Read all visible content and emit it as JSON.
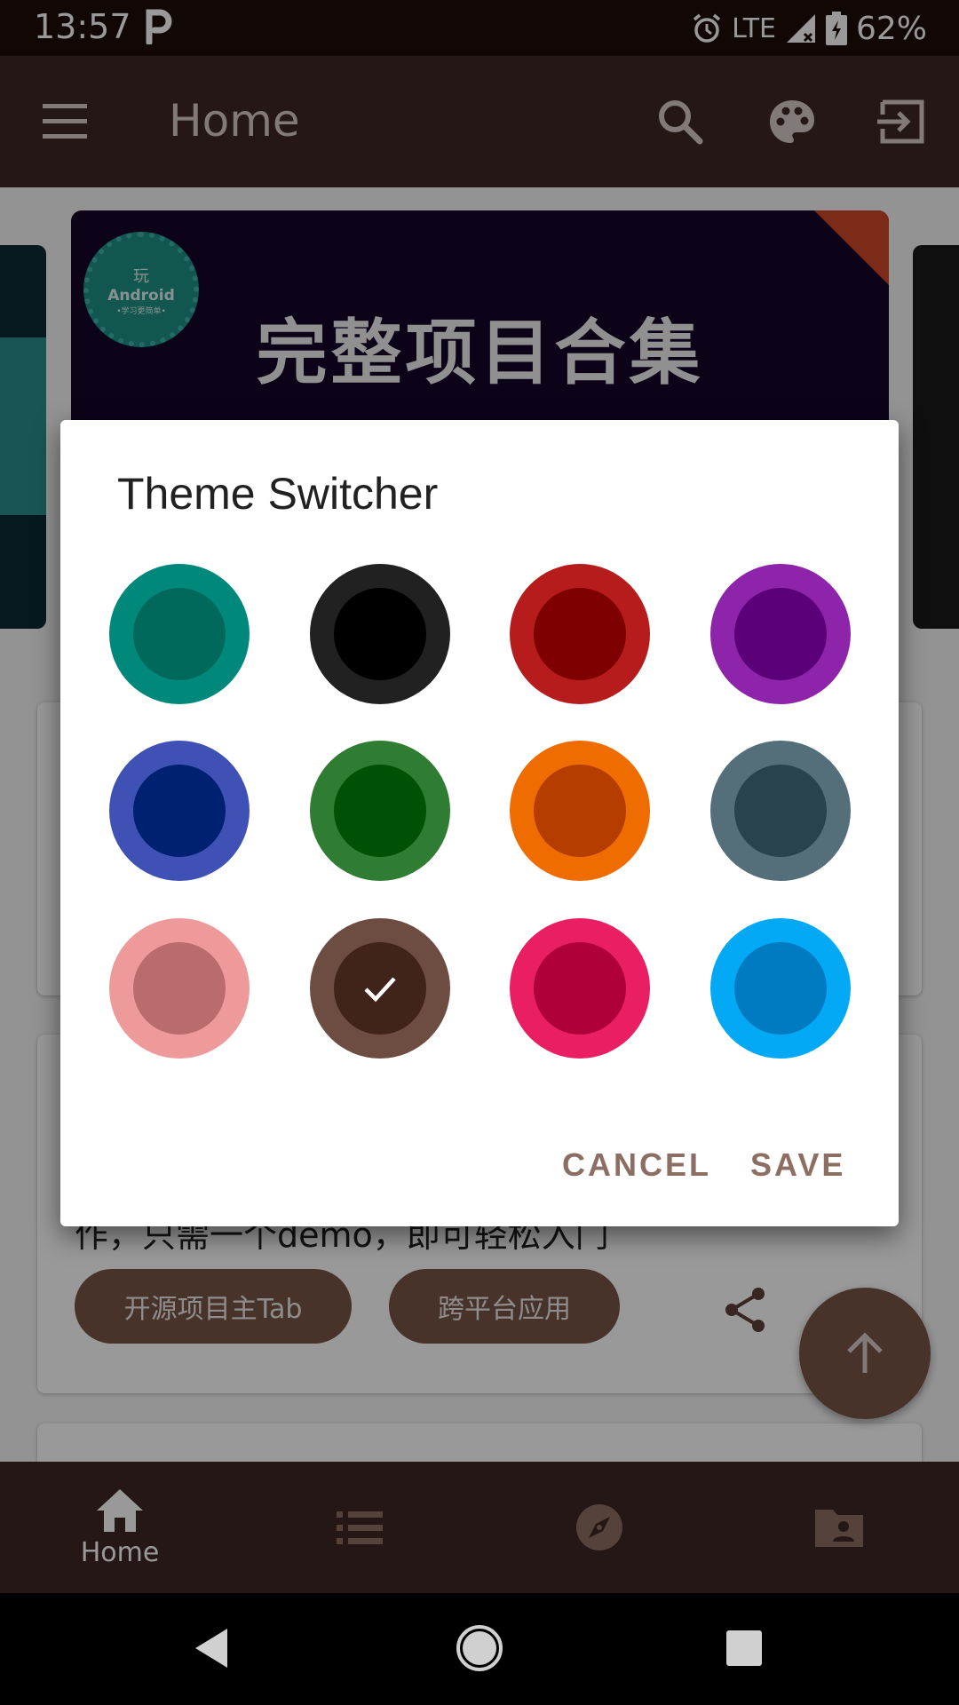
{
  "status_bar": {
    "time": "13:57",
    "network": "LTE",
    "battery": "62%"
  },
  "app_bar": {
    "title": "Home"
  },
  "banner": {
    "logo_line1": "玩",
    "logo_line2": "Android",
    "logo_line3": "•学习更简单•",
    "text": "完整项目合集"
  },
  "card2": {
    "desc": "作，只需一个demo，即可轻松入门",
    "tags": [
      "开源项目主Tab",
      "跨平台应用"
    ]
  },
  "bottom_nav": {
    "home_label": "Home"
  },
  "dialog": {
    "title": "Theme Switcher",
    "cancel": "CANCEL",
    "save": "SAVE",
    "swatches": [
      {
        "outer": "#00897b",
        "inner": "#00695c",
        "selected": false
      },
      {
        "outer": "#212121",
        "inner": "#000000",
        "selected": false
      },
      {
        "outer": "#b71c1c",
        "inner": "#7f0000",
        "selected": false
      },
      {
        "outer": "#8e24aa",
        "inner": "#5c007a",
        "selected": false
      },
      {
        "outer": "#3f51b5",
        "inner": "#002171",
        "selected": false
      },
      {
        "outer": "#2e7d32",
        "inner": "#005005",
        "selected": false
      },
      {
        "outer": "#ef6c00",
        "inner": "#b53d00",
        "selected": false
      },
      {
        "outer": "#546e7a",
        "inner": "#29434e",
        "selected": false
      },
      {
        "outer": "#ef9a9a",
        "inner": "#ba6b6c",
        "selected": false
      },
      {
        "outer": "#6d4c41",
        "inner": "#40241a",
        "selected": true
      },
      {
        "outer": "#e91e63",
        "inner": "#b0003a",
        "selected": false
      },
      {
        "outer": "#03a9f4",
        "inner": "#007ac1",
        "selected": false
      }
    ]
  },
  "colors": {
    "primary": "#3e2723",
    "accent": "#795548",
    "dialog_button": "#8d6e63"
  }
}
